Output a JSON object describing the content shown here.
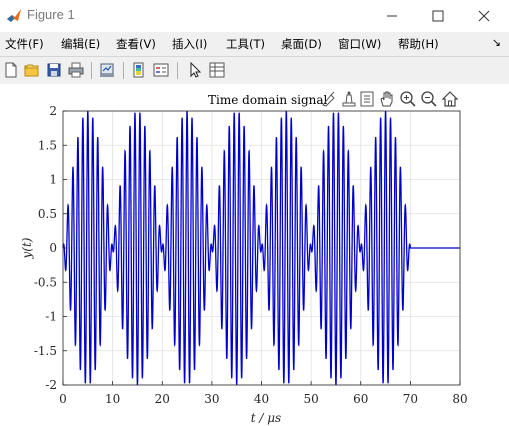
{
  "window": {
    "title": "Figure 1"
  },
  "menu": [
    "文件(F)",
    "编辑(E)",
    "查看(V)",
    "插入(I)",
    "工具(T)",
    "桌面(D)",
    "窗口(W)",
    "帮助(H)"
  ],
  "toolbar_icons": [
    "new-figure-icon",
    "open-file-icon",
    "save-icon",
    "print-icon",
    "link-plot-icon",
    "insert-colorbar-icon",
    "insert-legend-icon",
    "edit-plot-icon",
    "property-inspector-icon"
  ],
  "axes_toolbar_icons": [
    "brush-icon",
    "data-tips-icon",
    "export-icon",
    "pan-icon",
    "zoom-in-icon",
    "zoom-out-icon",
    "home-icon"
  ],
  "chart_data": {
    "type": "line",
    "title": "Time domain signal",
    "xlabel": "t / μs",
    "ylabel": "y(t)",
    "xlim": [
      0,
      80
    ],
    "ylim": [
      -2,
      2
    ],
    "xticks": [
      "0",
      "10",
      "20",
      "30",
      "40",
      "50",
      "60",
      "70",
      "80"
    ],
    "yticks": [
      "2",
      "1.5",
      "1",
      "0.5",
      "0",
      "-0.5",
      "-1",
      "-1.5",
      "-2"
    ],
    "grid": true,
    "series": [
      {
        "color": "#0000cc",
        "formula": "y = 2*sin(2*pi*t/20)*cos(2*pi*1*t) for 0<=t<=70, 0 otherwise",
        "envelope_period": 20,
        "carrier_frequency": 1,
        "amplitude": 2,
        "signal_end": 70
      }
    ]
  }
}
